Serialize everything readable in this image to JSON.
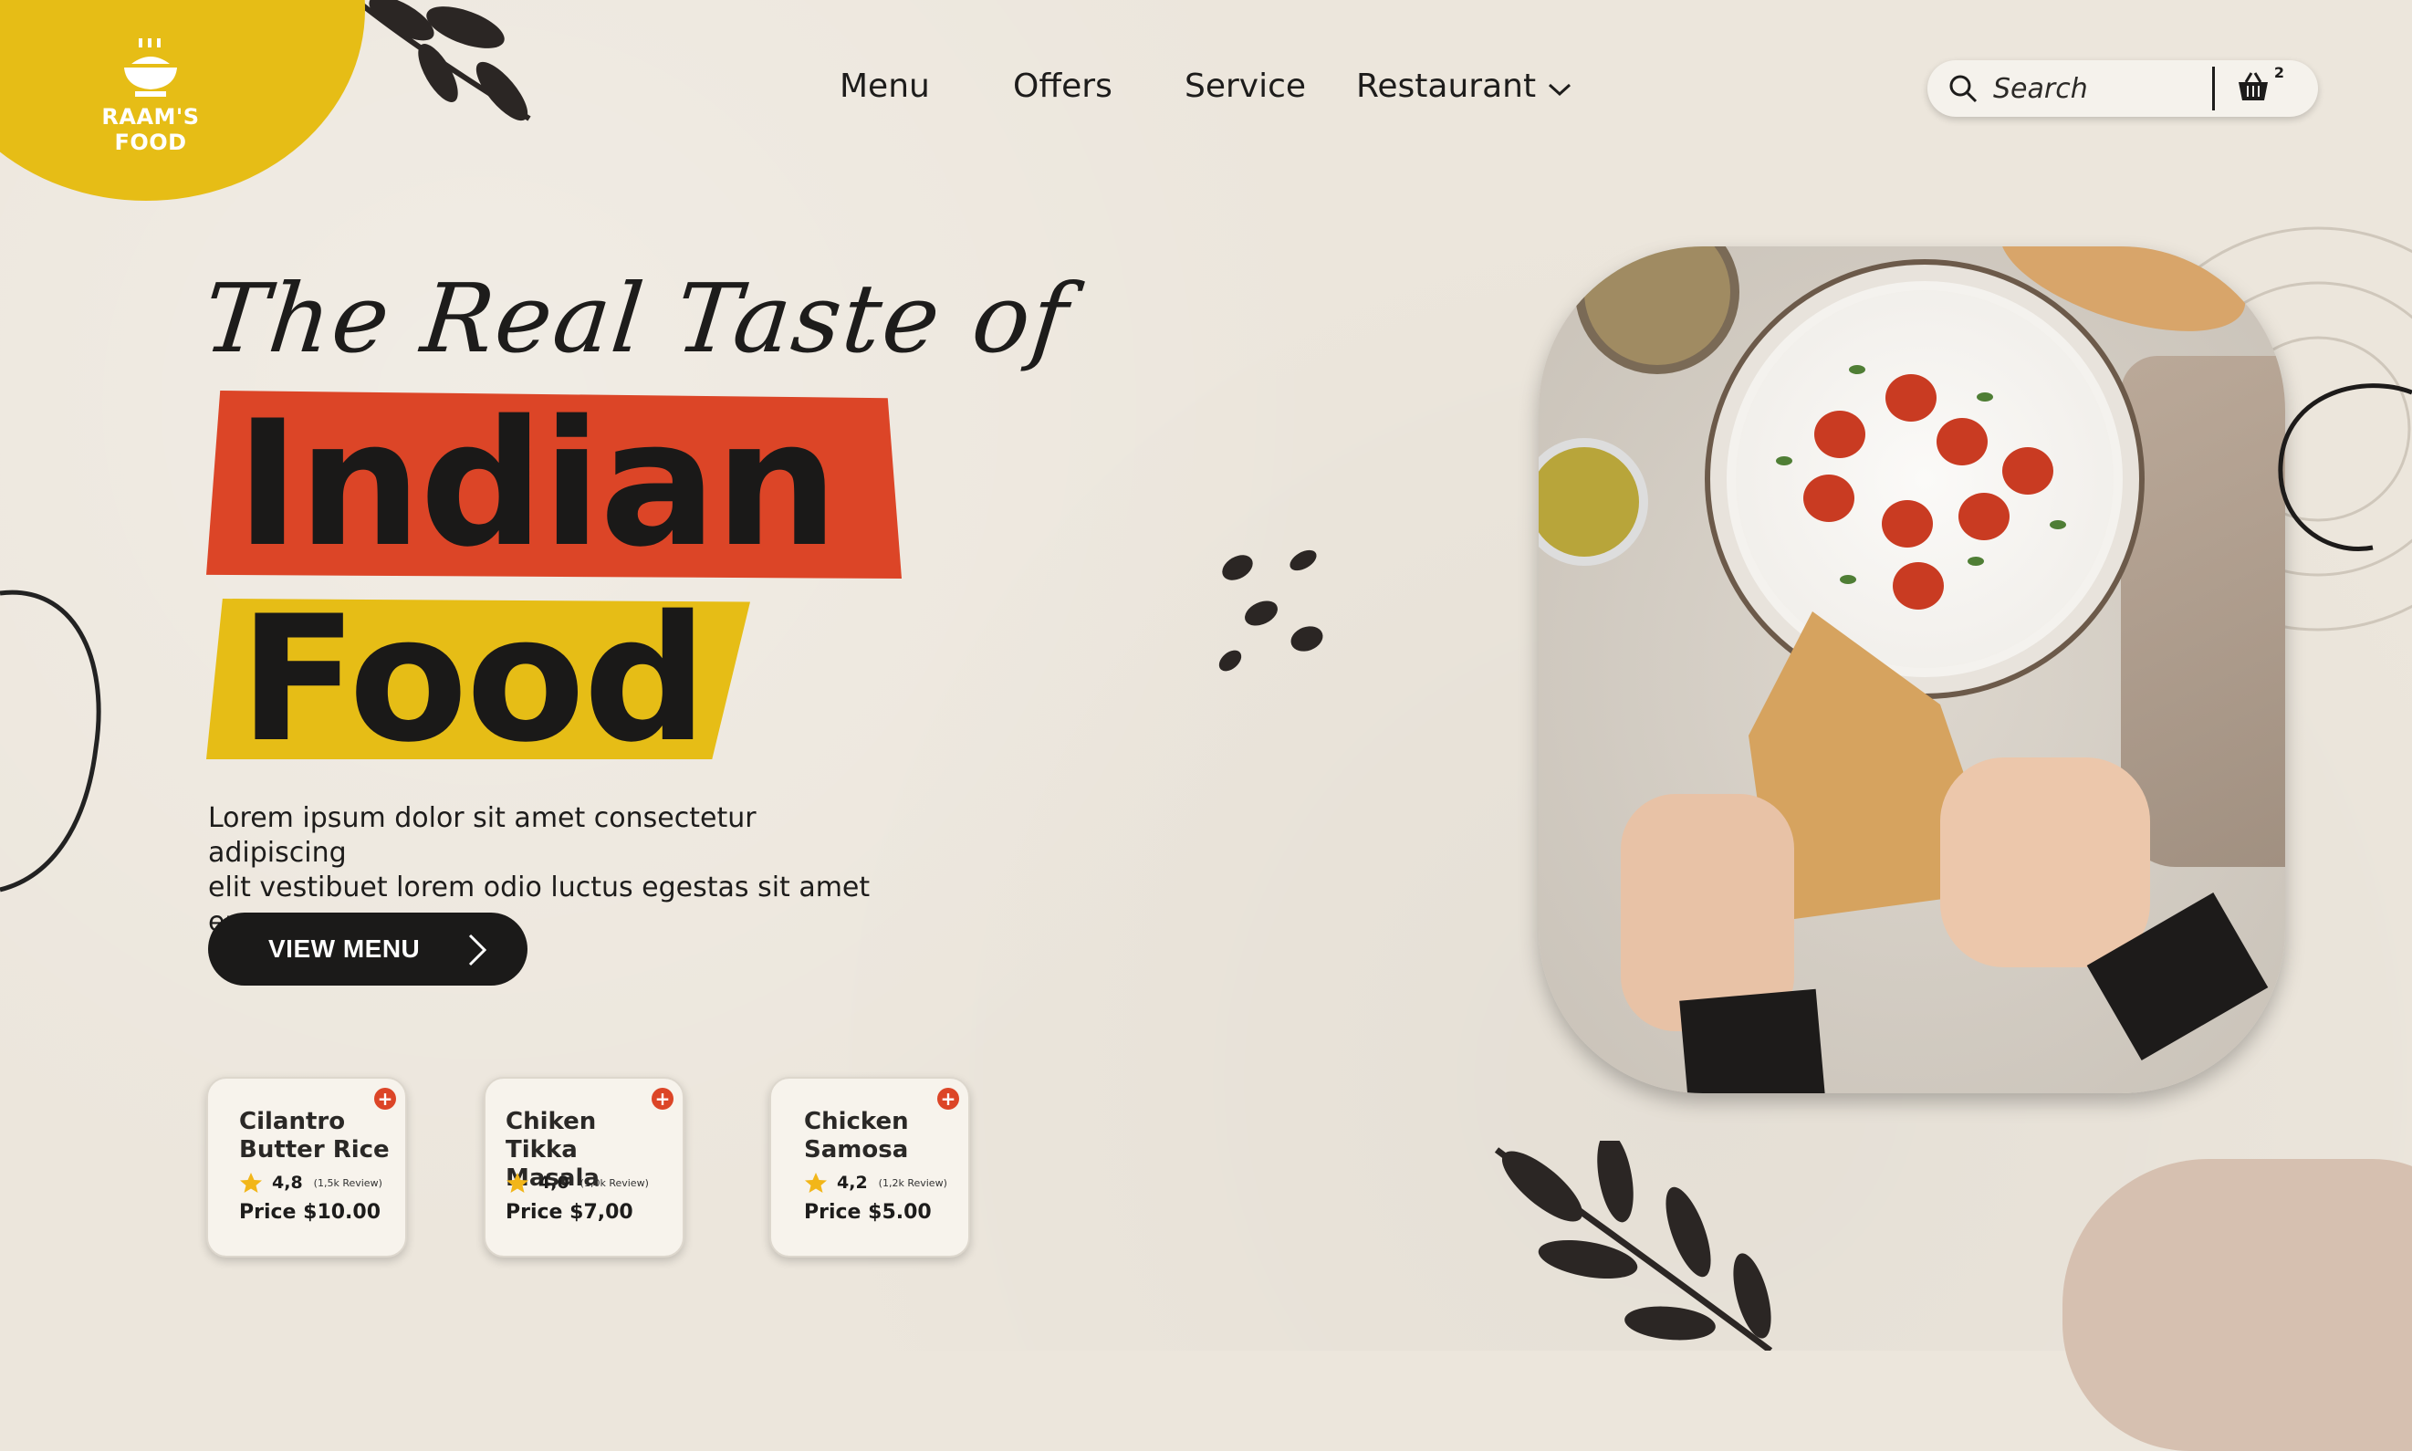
{
  "brand": {
    "name": "RAAM'S FOOD",
    "logo_icon": "food-bowl-icon",
    "accent": "#e6bd16"
  },
  "nav": {
    "items": [
      {
        "label": "Menu"
      },
      {
        "label": "Offers"
      },
      {
        "label": "Service"
      },
      {
        "label": "Restaurant",
        "icon": "chevron-down-icon"
      }
    ]
  },
  "search": {
    "placeholder": "Search",
    "icon": "search-icon"
  },
  "cart": {
    "icon": "basket-icon",
    "count": "2"
  },
  "hero": {
    "tagline": "The Real Taste of",
    "line1": "Indian",
    "line2": "Food",
    "line1_bg": "#dc4527",
    "line2_bg": "#e6bd16",
    "description_line1": "Lorem ipsum dolor sit amet consectetur adipiscing",
    "description_line2": "elit vestibuet lorem odio luctus egestas sit amet eu",
    "cta_label": "VIEW MENU"
  },
  "dishes": [
    {
      "name_line1": "Cilantro",
      "name_line2": "Butter Rice",
      "rating": "4,8",
      "reviews": "(1,5k Review)",
      "price": "Price $10.00"
    },
    {
      "name_line1": "Chiken",
      "name_line2": "Tikka Masala",
      "rating": "4,0",
      "reviews": "(1,0k Review)",
      "price": "Price $7,00"
    },
    {
      "name_line1": "Chicken",
      "name_line2": "Samosa",
      "rating": "4,2",
      "reviews": "(1,2k Review)",
      "price": "Price $5.00"
    }
  ]
}
